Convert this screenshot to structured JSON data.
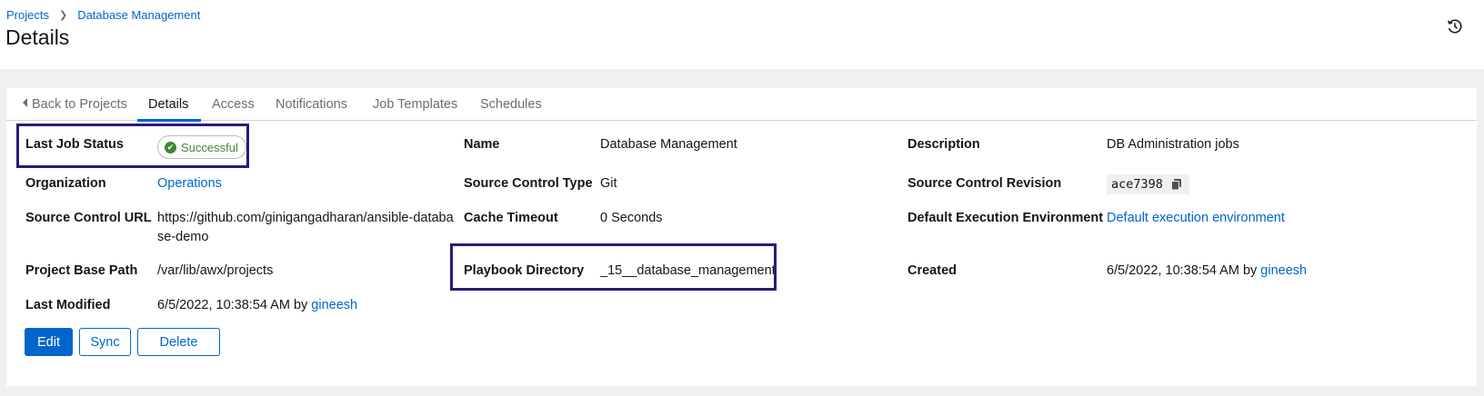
{
  "header": {
    "breadcrumb": {
      "projects": "Projects",
      "current": "Database Management"
    },
    "title": "Details",
    "history_icon": "history-icon"
  },
  "tabs": {
    "back": "Back to Projects",
    "details": "Details",
    "access": "Access",
    "notifications": "Notifications",
    "job_templates": "Job Templates",
    "schedules": "Schedules"
  },
  "details": {
    "last_job_status": {
      "label": "Last Job Status",
      "value": "Successful",
      "icon": "check-circle-icon",
      "color": "#3e8635"
    },
    "name": {
      "label": "Name",
      "value": "Database Management"
    },
    "description": {
      "label": "Description",
      "value": "DB Administration jobs"
    },
    "organization": {
      "label": "Organization",
      "value": "Operations"
    },
    "source_control_type": {
      "label": "Source Control Type",
      "value": "Git"
    },
    "source_control_revision": {
      "label": "Source Control Revision",
      "value": "ace7398",
      "icon": "copy-icon"
    },
    "source_control_url": {
      "label": "Source Control URL",
      "value": "https://github.com/ginigangadharan/ansible-database-demo"
    },
    "cache_timeout": {
      "label": "Cache Timeout",
      "value": "0 Seconds"
    },
    "default_execution_environment": {
      "label": "Default Execution Environment",
      "value": "Default execution environment"
    },
    "project_base_path": {
      "label": "Project Base Path",
      "value": "/var/lib/awx/projects"
    },
    "playbook_directory": {
      "label": "Playbook Directory",
      "value": "_15__database_management"
    },
    "created": {
      "label": "Created",
      "date": "6/5/2022, 10:38:54 AM by",
      "user": "gineesh"
    },
    "last_modified": {
      "label": "Last Modified",
      "date": "6/5/2022, 10:38:54 AM by",
      "user": "gineesh"
    }
  },
  "actions": {
    "edit": "Edit",
    "sync": "Sync",
    "delete": "Delete"
  },
  "colors": {
    "link": "#0066cc",
    "highlight": "#2b1a7a",
    "success": "#3e8635"
  }
}
